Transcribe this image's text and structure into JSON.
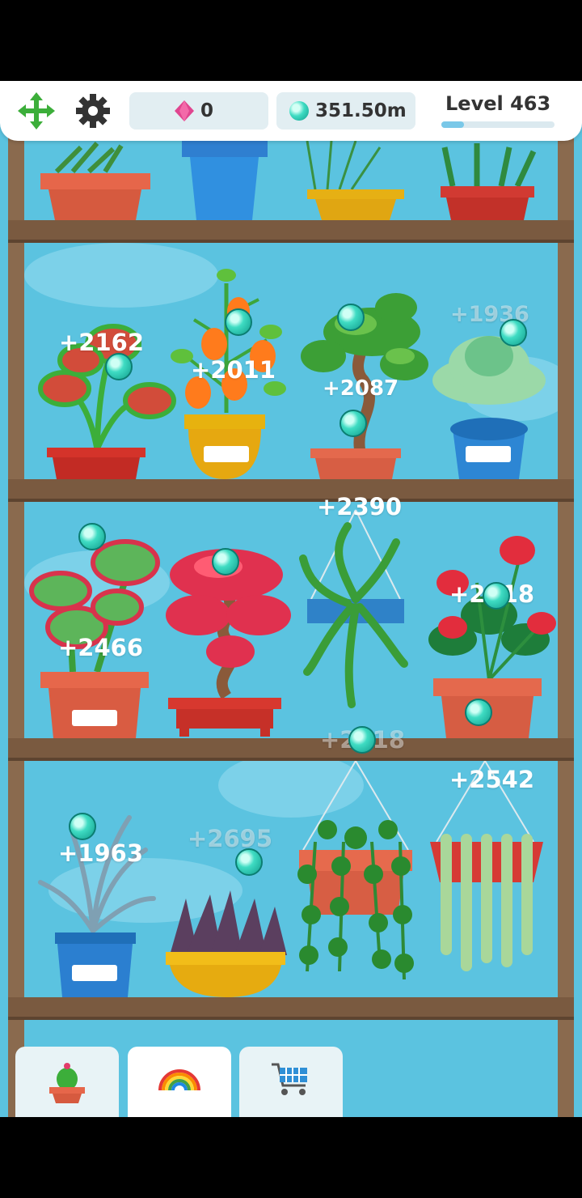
{
  "hud": {
    "move_icon": "arrows-move-icon",
    "settings_icon": "gear-icon",
    "gems": "0",
    "gem_icon": "pink-gem-icon",
    "drops": "351.50m",
    "drop_icon": "teal-drop-icon",
    "level_label": "Level 463",
    "level_progress": 0.2
  },
  "plants": [
    {
      "name": "venus-flytrap",
      "income": "+2162",
      "faded": false
    },
    {
      "name": "chinese-lantern",
      "income": "+2011",
      "faded": false
    },
    {
      "name": "bonsai-tree",
      "income": "+2087",
      "faded": false
    },
    {
      "name": "succulent",
      "income": "+1936",
      "faded": true
    },
    {
      "name": "red-succulent",
      "income": "+2466",
      "faded": false
    },
    {
      "name": "japanese-maple-bonsai",
      "income": "",
      "faded": false
    },
    {
      "name": "hanging-fern",
      "income": "+2390",
      "faded": false
    },
    {
      "name": "anthurium",
      "income": "+2218",
      "faded": false
    },
    {
      "name": "dusty-miller",
      "income": "+1963",
      "faded": false
    },
    {
      "name": "purple-agave",
      "income": "+2695",
      "faded": true
    },
    {
      "name": "hanging-ivy",
      "income": "+2318",
      "faded": true
    },
    {
      "name": "string-of-pearls",
      "income": "+2542",
      "faded": false
    }
  ],
  "tabs": [
    {
      "name": "plants-tab",
      "icon": "cactus-icon"
    },
    {
      "name": "decor-tab",
      "icon": "rainbow-icon"
    },
    {
      "name": "shop-tab",
      "icon": "shopping-cart-icon"
    }
  ],
  "colors": {
    "sky": "#5bc3e0",
    "wood": "#7a5a40",
    "accent": "#3fdcc3"
  }
}
